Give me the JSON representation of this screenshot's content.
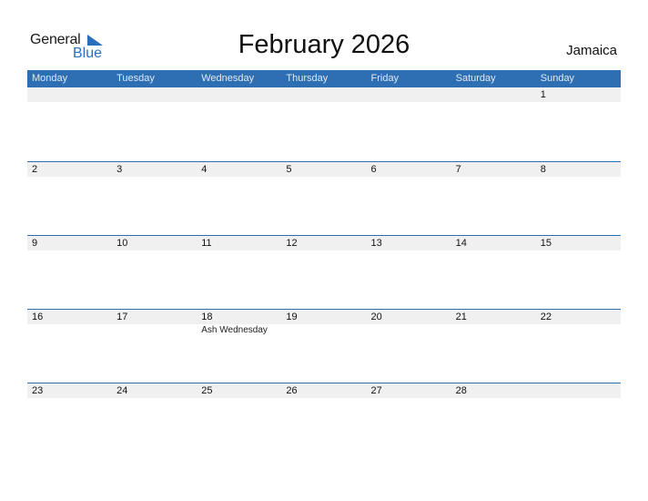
{
  "logo": {
    "general": "General",
    "blue": "Blue",
    "accent": "#2a6fbb"
  },
  "title": "February 2026",
  "country": "Jamaica",
  "colors": {
    "header_bg": "#2e6fb3",
    "strip_bg": "#f0f0f0"
  },
  "weekdays": [
    "Monday",
    "Tuesday",
    "Wednesday",
    "Thursday",
    "Friday",
    "Saturday",
    "Sunday"
  ],
  "weeks": [
    [
      {
        "d": ""
      },
      {
        "d": ""
      },
      {
        "d": ""
      },
      {
        "d": ""
      },
      {
        "d": ""
      },
      {
        "d": ""
      },
      {
        "d": "1"
      }
    ],
    [
      {
        "d": "2"
      },
      {
        "d": "3"
      },
      {
        "d": "4"
      },
      {
        "d": "5"
      },
      {
        "d": "6"
      },
      {
        "d": "7"
      },
      {
        "d": "8"
      }
    ],
    [
      {
        "d": "9"
      },
      {
        "d": "10"
      },
      {
        "d": "11"
      },
      {
        "d": "12"
      },
      {
        "d": "13"
      },
      {
        "d": "14"
      },
      {
        "d": "15"
      }
    ],
    [
      {
        "d": "16"
      },
      {
        "d": "17"
      },
      {
        "d": "18",
        "event": "Ash Wednesday"
      },
      {
        "d": "19"
      },
      {
        "d": "20"
      },
      {
        "d": "21"
      },
      {
        "d": "22"
      }
    ],
    [
      {
        "d": "23"
      },
      {
        "d": "24"
      },
      {
        "d": "25"
      },
      {
        "d": "26"
      },
      {
        "d": "27"
      },
      {
        "d": "28"
      },
      {
        "d": ""
      }
    ]
  ]
}
